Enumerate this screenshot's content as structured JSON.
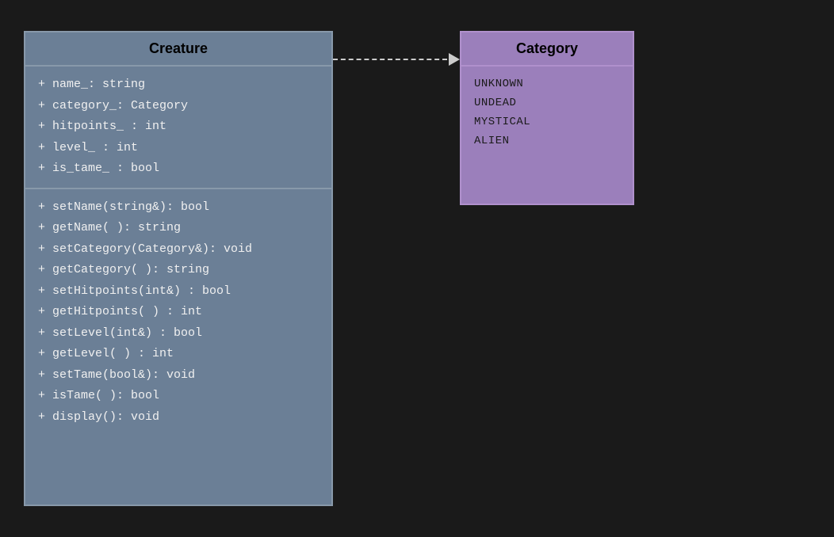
{
  "background_color": "#1a1a1a",
  "creature": {
    "title": "Creature",
    "attributes": [
      "+ name_: string",
      "+ category_: Category",
      "+ hitpoints_ : int",
      "+ level_ : int",
      "+ is_tame_ : bool"
    ],
    "methods": [
      "+ setName(string&): bool",
      "+ getName( ): string",
      "+ setCategory(Category&):  void",
      "+ getCategory( ): string",
      "+ setHitpoints(int&) : bool",
      "+ getHitpoints( ) : int",
      "+ setLevel(int&) : bool",
      "+ getLevel( ) : int",
      "+ setTame(bool&): void",
      "+ isTame( ): bool",
      "+ display(): void"
    ]
  },
  "category": {
    "title": "Category",
    "items": [
      "UNKNOWN",
      "UNDEAD",
      "MYSTICAL",
      "ALIEN"
    ]
  },
  "arrow": {
    "type": "dashed"
  }
}
